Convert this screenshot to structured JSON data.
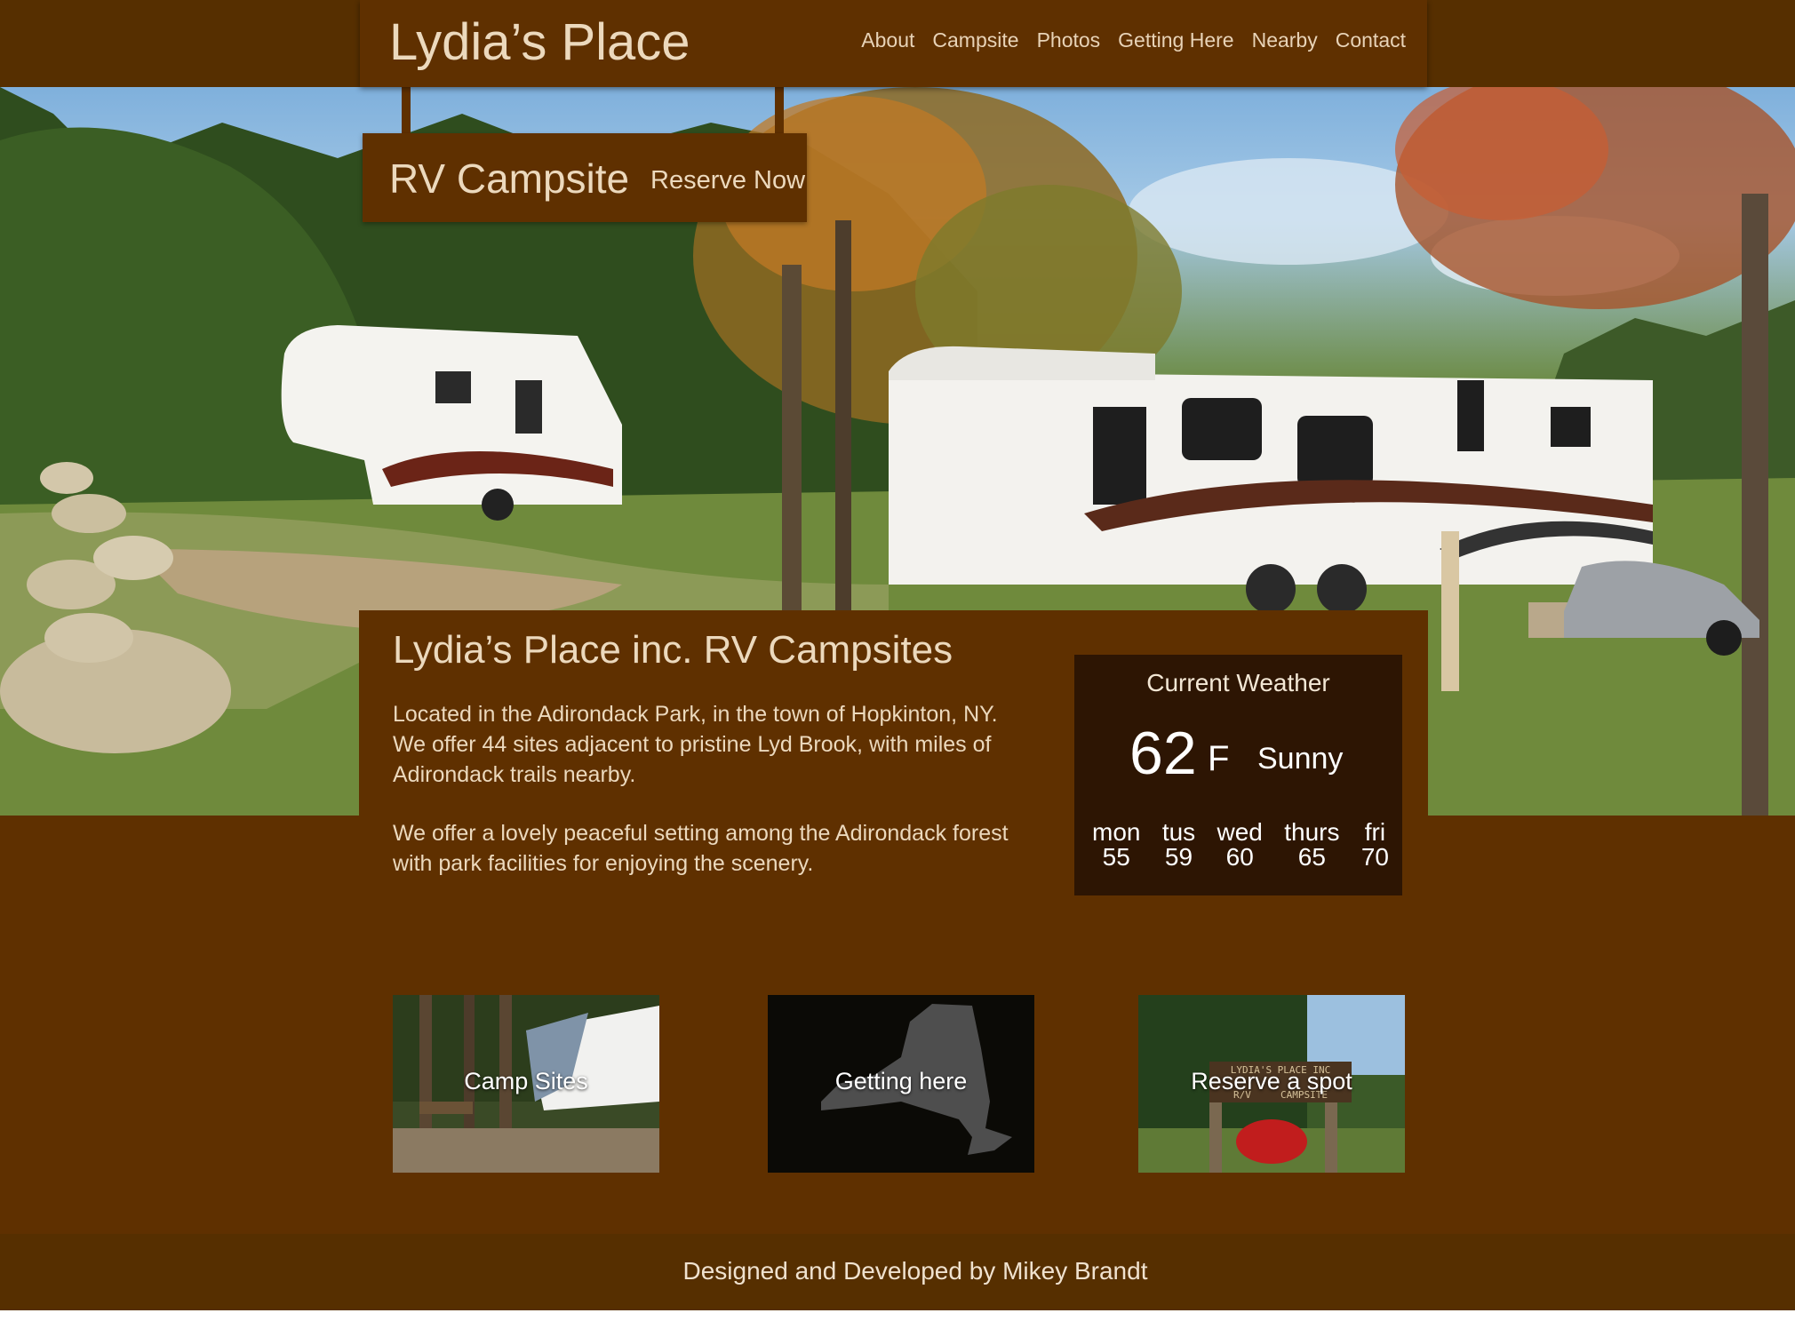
{
  "header": {
    "site_title": "Lydia’s Place",
    "nav": [
      "About",
      "Campsite",
      "Photos",
      "Getting Here",
      "Nearby",
      "Contact"
    ]
  },
  "hero": {
    "page_title": "RV Campsite",
    "reserve_label": "Reserve Now"
  },
  "main": {
    "heading": "Lydia’s Place inc. RV Campsites",
    "paragraph1": "Located in the Adirondack Park, in the town of Hopkinton, NY. We offer 44 sites adjacent to pristine Lyd Brook, with miles of Adirondack trails nearby.",
    "paragraph2": "We offer a lovely peaceful setting among the Adirondack forest with park facilities for enjoying the scenery."
  },
  "weather": {
    "title": "Current Weather",
    "temp": "62",
    "unit": "F",
    "condition": "Sunny",
    "forecast": [
      {
        "day": "mon",
        "temp": "55"
      },
      {
        "day": "tus",
        "temp": "59"
      },
      {
        "day": "wed",
        "temp": "60"
      },
      {
        "day": "thurs",
        "temp": "65"
      },
      {
        "day": "fri",
        "temp": "70"
      }
    ]
  },
  "cards": [
    {
      "label": "Camp Sites"
    },
    {
      "label": "Getting here"
    },
    {
      "label": "Reserve a spot",
      "sign_line1": "LYDIA'S PLACE INC",
      "sign_line2": "R/V     CAMPSITE"
    }
  ],
  "footer": {
    "credit": "Designed and Developed by Mikey Brandt"
  },
  "colors": {
    "brand_brown": "#5f3000",
    "dark_brown": "#562f00",
    "weather_bg": "#2d1503",
    "text_cream": "#ecd9bd"
  }
}
